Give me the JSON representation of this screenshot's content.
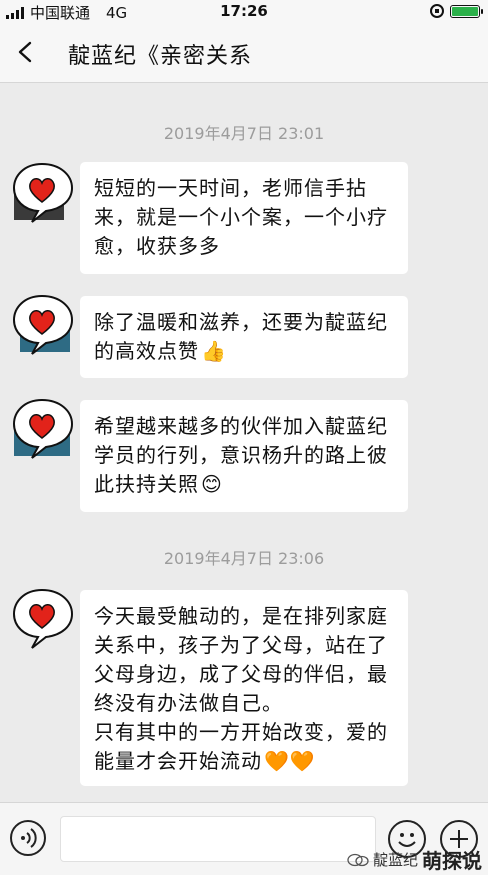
{
  "status_bar": {
    "carrier": "中国联通",
    "network": "4G",
    "time": "17:26"
  },
  "nav": {
    "title": "靛蓝纪《亲密关系"
  },
  "messages": [
    {
      "type": "timestamp",
      "text": "2019年4月7日 23:01"
    },
    {
      "type": "bubble",
      "text": "短短的一天时间，老师信手拈来，就是一个小个案，一个小疗愈，收获多多",
      "emoji": ""
    },
    {
      "type": "bubble",
      "text": "除了温暖和滋养，还要为靛蓝纪的高效点赞",
      "emoji": "👍"
    },
    {
      "type": "bubble",
      "text": "希望越来越多的伙伴加入靛蓝纪学员的行列，意识杨升的路上彼此扶持关照",
      "emoji": "😊"
    },
    {
      "type": "timestamp",
      "text": "2019年4月7日 23:06"
    },
    {
      "type": "bubble",
      "text": "今天最受触动的，是在排列家庭关系中，孩子为了父母，站在了父母身边，成了父母的伴侣，最终没有办法做自己。",
      "text2": "只有其中的一方开始改变，爱的能量才会开始流动",
      "emoji": "🧡🧡"
    }
  ],
  "watermark": {
    "small": "靛蓝纪",
    "big": "萌探说"
  },
  "colors": {
    "heart": "#e2231a",
    "background": "#ebebeb",
    "battery": "#2bb14a"
  }
}
